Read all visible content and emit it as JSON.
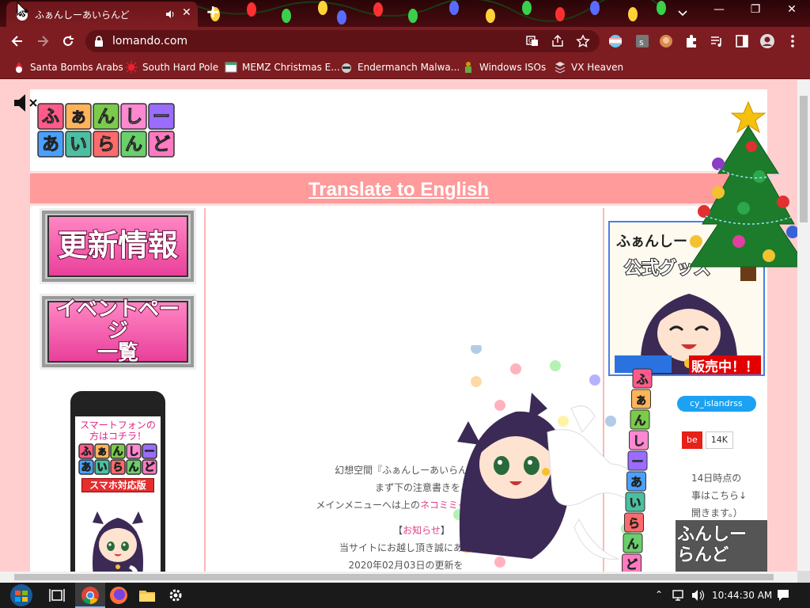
{
  "browser": {
    "tab_title": "ふぁんしーあいらんど",
    "url": "lomando.com",
    "bookmarks": [
      {
        "label": "Santa Bombs Arabs"
      },
      {
        "label": "South Hard Pole"
      },
      {
        "label": "MEMZ Christmas E..."
      },
      {
        "label": "Endermanch Malwa..."
      },
      {
        "label": "Windows ISOs"
      },
      {
        "label": "VX Heaven"
      }
    ],
    "colors": {
      "frame": "#7d1d21",
      "tab_strip": "#3a080c"
    }
  },
  "page": {
    "logo_row1": [
      "ふ",
      "ぁ",
      "ん",
      "し",
      "ー"
    ],
    "logo_row2": [
      "あ",
      "い",
      "ら",
      "ん",
      "ど"
    ],
    "translate_link": "Translate to English",
    "left": {
      "update_button": "更新情報",
      "event_button_line1": "イベントページ",
      "event_button_line2": "一覧",
      "phone_text_line1": "スマートフォンの",
      "phone_text_line2": "方はコチラ！",
      "phone_logo_row1": [
        "ふ",
        "ぁ",
        "ん",
        "し",
        "ー"
      ],
      "phone_logo_row2": [
        "あ",
        "い",
        "ら",
        "ん",
        "ど"
      ],
      "phone_badge": "スマホ対応版"
    },
    "main": {
      "line1": "幻想空間『ふぁんしーあいらんど",
      "line2": "まず下の注意書きをよく",
      "line3_prefix": "メインメニューへは上の",
      "line3_link": "ネコミミイラスト",
      "news_heading_open": "【",
      "news_heading_link": "お知らせ",
      "news_heading_close": "】",
      "line4": "当サイトにお越し頂き誠にあり",
      "line5": "2020年02月03日の更新を"
    },
    "right": {
      "goods_title": "ふぁんしー",
      "goods_subtitle": "公式グッズ",
      "goods_sell": "販売中！！",
      "twitter": "cy_islandrss",
      "youtube": "be",
      "youtube_count": "14K",
      "text1": "14日時点の",
      "text2": "事はこちら↓",
      "text3": "開きます。）",
      "banner_line1": "ふんしー",
      "banner_line2": "らんど"
    },
    "overlay_letters": [
      "ふ",
      "ぁ",
      "ん",
      "し",
      "ー",
      "あ",
      "い",
      "ら",
      "ん",
      "ど"
    ]
  },
  "taskbar": {
    "time": "10:44:30 AM"
  }
}
